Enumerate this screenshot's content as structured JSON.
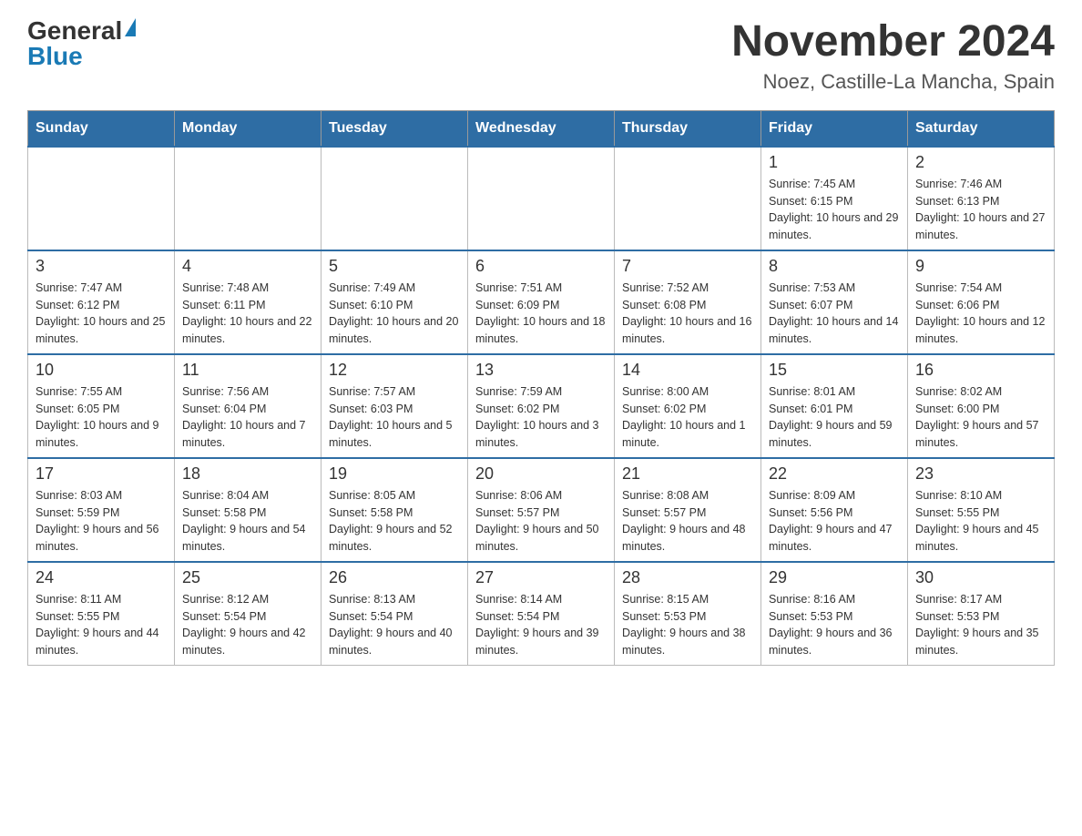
{
  "header": {
    "logo_general": "General",
    "logo_blue": "Blue",
    "title": "November 2024",
    "subtitle": "Noez, Castille-La Mancha, Spain"
  },
  "days_of_week": [
    "Sunday",
    "Monday",
    "Tuesday",
    "Wednesday",
    "Thursday",
    "Friday",
    "Saturday"
  ],
  "weeks": [
    [
      {
        "day": "",
        "info": ""
      },
      {
        "day": "",
        "info": ""
      },
      {
        "day": "",
        "info": ""
      },
      {
        "day": "",
        "info": ""
      },
      {
        "day": "",
        "info": ""
      },
      {
        "day": "1",
        "info": "Sunrise: 7:45 AM\nSunset: 6:15 PM\nDaylight: 10 hours and 29 minutes."
      },
      {
        "day": "2",
        "info": "Sunrise: 7:46 AM\nSunset: 6:13 PM\nDaylight: 10 hours and 27 minutes."
      }
    ],
    [
      {
        "day": "3",
        "info": "Sunrise: 7:47 AM\nSunset: 6:12 PM\nDaylight: 10 hours and 25 minutes."
      },
      {
        "day": "4",
        "info": "Sunrise: 7:48 AM\nSunset: 6:11 PM\nDaylight: 10 hours and 22 minutes."
      },
      {
        "day": "5",
        "info": "Sunrise: 7:49 AM\nSunset: 6:10 PM\nDaylight: 10 hours and 20 minutes."
      },
      {
        "day": "6",
        "info": "Sunrise: 7:51 AM\nSunset: 6:09 PM\nDaylight: 10 hours and 18 minutes."
      },
      {
        "day": "7",
        "info": "Sunrise: 7:52 AM\nSunset: 6:08 PM\nDaylight: 10 hours and 16 minutes."
      },
      {
        "day": "8",
        "info": "Sunrise: 7:53 AM\nSunset: 6:07 PM\nDaylight: 10 hours and 14 minutes."
      },
      {
        "day": "9",
        "info": "Sunrise: 7:54 AM\nSunset: 6:06 PM\nDaylight: 10 hours and 12 minutes."
      }
    ],
    [
      {
        "day": "10",
        "info": "Sunrise: 7:55 AM\nSunset: 6:05 PM\nDaylight: 10 hours and 9 minutes."
      },
      {
        "day": "11",
        "info": "Sunrise: 7:56 AM\nSunset: 6:04 PM\nDaylight: 10 hours and 7 minutes."
      },
      {
        "day": "12",
        "info": "Sunrise: 7:57 AM\nSunset: 6:03 PM\nDaylight: 10 hours and 5 minutes."
      },
      {
        "day": "13",
        "info": "Sunrise: 7:59 AM\nSunset: 6:02 PM\nDaylight: 10 hours and 3 minutes."
      },
      {
        "day": "14",
        "info": "Sunrise: 8:00 AM\nSunset: 6:02 PM\nDaylight: 10 hours and 1 minute."
      },
      {
        "day": "15",
        "info": "Sunrise: 8:01 AM\nSunset: 6:01 PM\nDaylight: 9 hours and 59 minutes."
      },
      {
        "day": "16",
        "info": "Sunrise: 8:02 AM\nSunset: 6:00 PM\nDaylight: 9 hours and 57 minutes."
      }
    ],
    [
      {
        "day": "17",
        "info": "Sunrise: 8:03 AM\nSunset: 5:59 PM\nDaylight: 9 hours and 56 minutes."
      },
      {
        "day": "18",
        "info": "Sunrise: 8:04 AM\nSunset: 5:58 PM\nDaylight: 9 hours and 54 minutes."
      },
      {
        "day": "19",
        "info": "Sunrise: 8:05 AM\nSunset: 5:58 PM\nDaylight: 9 hours and 52 minutes."
      },
      {
        "day": "20",
        "info": "Sunrise: 8:06 AM\nSunset: 5:57 PM\nDaylight: 9 hours and 50 minutes."
      },
      {
        "day": "21",
        "info": "Sunrise: 8:08 AM\nSunset: 5:57 PM\nDaylight: 9 hours and 48 minutes."
      },
      {
        "day": "22",
        "info": "Sunrise: 8:09 AM\nSunset: 5:56 PM\nDaylight: 9 hours and 47 minutes."
      },
      {
        "day": "23",
        "info": "Sunrise: 8:10 AM\nSunset: 5:55 PM\nDaylight: 9 hours and 45 minutes."
      }
    ],
    [
      {
        "day": "24",
        "info": "Sunrise: 8:11 AM\nSunset: 5:55 PM\nDaylight: 9 hours and 44 minutes."
      },
      {
        "day": "25",
        "info": "Sunrise: 8:12 AM\nSunset: 5:54 PM\nDaylight: 9 hours and 42 minutes."
      },
      {
        "day": "26",
        "info": "Sunrise: 8:13 AM\nSunset: 5:54 PM\nDaylight: 9 hours and 40 minutes."
      },
      {
        "day": "27",
        "info": "Sunrise: 8:14 AM\nSunset: 5:54 PM\nDaylight: 9 hours and 39 minutes."
      },
      {
        "day": "28",
        "info": "Sunrise: 8:15 AM\nSunset: 5:53 PM\nDaylight: 9 hours and 38 minutes."
      },
      {
        "day": "29",
        "info": "Sunrise: 8:16 AM\nSunset: 5:53 PM\nDaylight: 9 hours and 36 minutes."
      },
      {
        "day": "30",
        "info": "Sunrise: 8:17 AM\nSunset: 5:53 PM\nDaylight: 9 hours and 35 minutes."
      }
    ]
  ]
}
